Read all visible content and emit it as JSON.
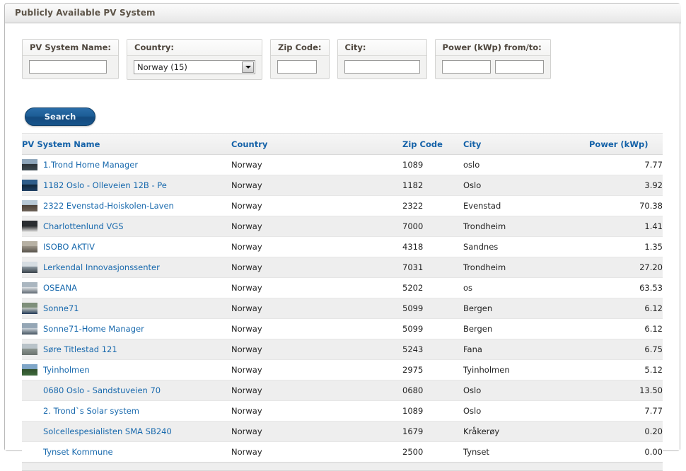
{
  "window": {
    "title": "Publicly Available PV System"
  },
  "filters": [
    {
      "key": "pv_system_name",
      "label": "PV System Name:",
      "type": "text",
      "value": "",
      "placeholder": ""
    },
    {
      "key": "country",
      "label": "Country:",
      "type": "select",
      "value": "Norway (15)",
      "placeholder": ""
    },
    {
      "key": "zip_code",
      "label": "Zip Code:",
      "type": "text",
      "value": "",
      "placeholder": ""
    },
    {
      "key": "city",
      "label": "City:",
      "type": "text",
      "value": "",
      "placeholder": ""
    },
    {
      "key": "power_range",
      "label": "Power (kWp) from/to:",
      "type": "text-range",
      "value_from": "",
      "value_to": "",
      "placeholder": ""
    }
  ],
  "filter_labels": {
    "pv_system_name": "PV System Name:",
    "country": "Country:",
    "zip_code": "Zip Code:",
    "city": "City:",
    "power": "Power (kWp) from/to:"
  },
  "filter_values": {
    "pv_system_name": "",
    "country_selected": "Norway (15)",
    "zip_code": "",
    "city": "",
    "power_from": "",
    "power_to": ""
  },
  "buttons": {
    "search": "Search"
  },
  "table": {
    "columns": [
      {
        "key": "name",
        "label": "PV System Name",
        "link": true,
        "align": "left"
      },
      {
        "key": "country",
        "label": "Country",
        "link": false,
        "align": "left"
      },
      {
        "key": "zip",
        "label": "Zip Code",
        "link": true,
        "align": "left"
      },
      {
        "key": "city",
        "label": "City",
        "link": true,
        "align": "left"
      },
      {
        "key": "power",
        "label": "Power (kWp)",
        "link": true,
        "align": "right"
      }
    ],
    "rows": [
      {
        "name": "1.Trond Home Manager",
        "country": "Norway",
        "zip": "1089",
        "city": "oslo",
        "power": "7.77",
        "thumb": true,
        "thumb_colors": [
          "#8fa6bb",
          "#3d4a52",
          "#2b3136"
        ]
      },
      {
        "name": "1182 Oslo - Olleveien 12B - Pe",
        "country": "Norway",
        "zip": "1182",
        "city": "Oslo",
        "power": "3.92",
        "thumb": true,
        "thumb_colors": [
          "#2f5d8a",
          "#1d3f63",
          "#0f2336"
        ]
      },
      {
        "name": "2322 Evenstad-Hoiskolen-Laven",
        "country": "Norway",
        "zip": "2322",
        "city": "Evenstad",
        "power": "70.38",
        "thumb": true,
        "thumb_colors": [
          "#b8c9d6",
          "#6d6257",
          "#4a4038"
        ]
      },
      {
        "name": "Charlottenlund VGS",
        "country": "Norway",
        "zip": "7000",
        "city": "Trondheim",
        "power": "1.41",
        "thumb": true,
        "thumb_colors": [
          "#2a2d31",
          "#e8e8e6",
          "#1b1d20"
        ]
      },
      {
        "name": "ISOBO AKTIV",
        "country": "Norway",
        "zip": "4318",
        "city": "Sandnes",
        "power": "1.35",
        "thumb": true,
        "thumb_colors": [
          "#b7b1a4",
          "#57524a",
          "#9b9488"
        ]
      },
      {
        "name": "Lerkendal Innovasjonssenter",
        "country": "Norway",
        "zip": "7031",
        "city": "Trondheim",
        "power": "27.20",
        "thumb": true,
        "thumb_colors": [
          "#d6dde2",
          "#3c454d",
          "#8e9aa3"
        ]
      },
      {
        "name": "OSEANA",
        "country": "Norway",
        "zip": "5202",
        "city": "os",
        "power": "63.53",
        "thumb": true,
        "thumb_colors": [
          "#aab6c0",
          "#5d6771",
          "#e2e6e9"
        ]
      },
      {
        "name": "Sonne71",
        "country": "Norway",
        "zip": "5099",
        "city": "Bergen",
        "power": "6.12",
        "thumb": true,
        "thumb_colors": [
          "#7e8f7a",
          "#243a58",
          "#c9cfc6"
        ]
      },
      {
        "name": "Sonne71-Home Manager",
        "country": "Norway",
        "zip": "5099",
        "city": "Bergen",
        "power": "6.12",
        "thumb": true,
        "thumb_colors": [
          "#94a6b5",
          "#45535f",
          "#cdd6dd"
        ]
      },
      {
        "name": "Søre Titlestad 121",
        "country": "Norway",
        "zip": "5243",
        "city": "Fana",
        "power": "6.75",
        "thumb": true,
        "thumb_colors": [
          "#b9c3c9",
          "#6a736f",
          "#8d9691"
        ]
      },
      {
        "name": "Tyinholmen",
        "country": "Norway",
        "zip": "2975",
        "city": "Tyinholmen",
        "power": "5.12",
        "thumb": true,
        "thumb_colors": [
          "#7fa6c8",
          "#3f6b3c",
          "#2f4f2c"
        ]
      },
      {
        "name": "0680 Oslo - Sandstuveien 70",
        "country": "Norway",
        "zip": "0680",
        "city": "Oslo",
        "power": "13.50",
        "thumb": false,
        "thumb_colors": []
      },
      {
        "name": "2. Trond`s Solar system",
        "country": "Norway",
        "zip": "1089",
        "city": "Oslo",
        "power": "7.77",
        "thumb": false,
        "thumb_colors": []
      },
      {
        "name": "Solcellespesialisten SMA SB240",
        "country": "Norway",
        "zip": "1679",
        "city": "Kråkerøy",
        "power": "0.20",
        "thumb": false,
        "thumb_colors": []
      },
      {
        "name": "Tynset Kommune",
        "country": "Norway",
        "zip": "2500",
        "city": "Tynset",
        "power": "0.00",
        "thumb": false,
        "thumb_colors": []
      }
    ]
  },
  "colors": {
    "link": "#1869ad",
    "header_link": "#1562a8",
    "header_static": "#6e665c",
    "title_text": "#5c5347",
    "button_bg": "#1d5d96",
    "row_even": "#eeeeee",
    "row_odd": "#ffffff"
  }
}
